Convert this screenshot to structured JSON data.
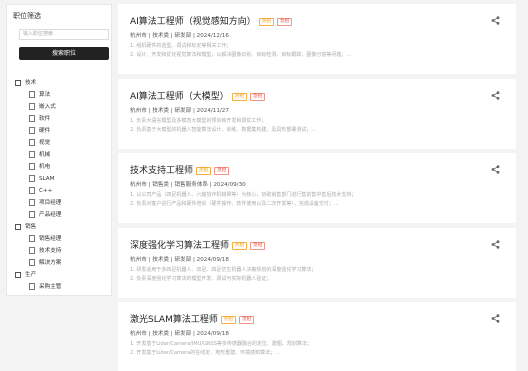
{
  "sidebar": {
    "title": "职位筛选",
    "search_placeholder": "输入职位搜索",
    "search_button": "搜索职位",
    "tree": [
      {
        "label": "技术",
        "children": [
          "算法",
          "嵌入式",
          "软件",
          "硬件",
          "视觉",
          "机械",
          "机电",
          "SLAM",
          "C++",
          "项目经理",
          "产品经理"
        ]
      },
      {
        "label": "销售",
        "children": [
          "销售经理",
          "技术支持",
          "解决方案"
        ]
      },
      {
        "label": "生产",
        "children": [
          "采购主管"
        ]
      }
    ]
  },
  "jobs": [
    {
      "title": "AI算法工程师（视觉感知方向）",
      "tags": [
        "热招",
        "急招"
      ],
      "meta": "杭州市 | 技术类 | 研发部 | 2024/12/16",
      "desc": [
        "1. 组机硬件的选型、调试和标定等相关工作；",
        "2. 设计、开发和优化视觉算法和模型，以解决图像识别、目标检测、目标跟踪、图像分割等问题；..."
      ]
    },
    {
      "title": "AI算法工程师（大模型）",
      "tags": [
        "热招",
        "急招"
      ],
      "meta": "杭州市 | 技术类 | 研发部 | 2024/11/27",
      "desc": [
        "1. 负责大语言模型及多模态大模型的预训练开发和调优工作；",
        "2. 负责基于大模型的机器人智能算法设计、训练、数据集构建，及具形部署测试；..."
      ]
    },
    {
      "title": "技术支持工程师",
      "tags": [
        "热招",
        "急招"
      ],
      "meta": "杭州市 | 销售类 | 销售服务体系 | 2024/09/30",
      "desc": [
        "1. 以公司产品（四足机器人、六轴协作机械臂等）为核心，协助销售部门进行售前售中售后技术支持；",
        "2. 负责对客户进行产品和硬件培训（硬件操作、软件使用以及二次开发等），完成设备交付；..."
      ]
    },
    {
      "title": "深度强化学习算法工程师",
      "tags": [
        "热招",
        "急招"
      ],
      "meta": "杭州市 | 技术类 | 研发部 | 2024/09/18",
      "desc": [
        "1. 研发适用于多四足机器人、双足、四足仿生机器人决策规划的深度强化学习算法；",
        "2. 负责深度强化学习算法的模型开发、调试与实际机器人验证；"
      ]
    },
    {
      "title": "激光SLAM算法工程师",
      "tags": [
        "热招",
        "急招"
      ],
      "meta": "杭州市 | 技术类 | 研发部 | 2024/09/18",
      "desc": [
        "1. 开发基于Lidar/Camera/IMU/GNSS等多传感器融合的定位、建图、规划算法；",
        "2. 开发基于Lidar/Camera的在线定、地形重建、环境感知算法；..."
      ]
    }
  ]
}
